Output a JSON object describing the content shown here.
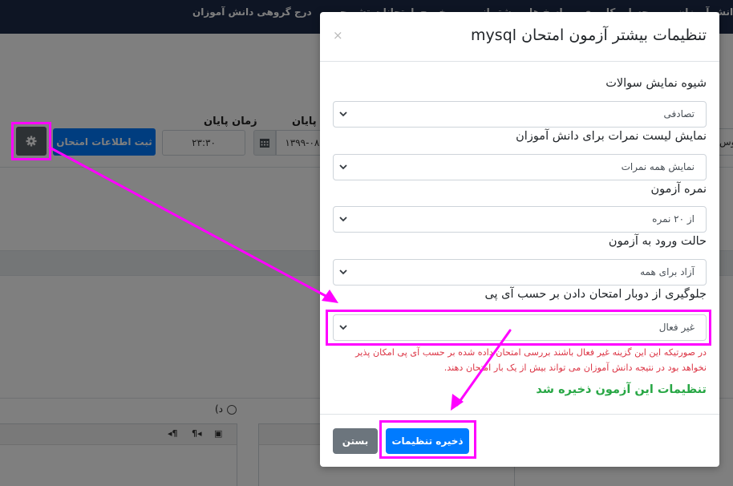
{
  "background": {
    "nav_items": [
      "دانش آموزان",
      "حساب کاربری",
      "پاسخ ها",
      "پشتیبانی",
      "خروج",
      "امتحانات تشریحی",
      "درج گروهی دانش آموزان"
    ],
    "end_date_label": "تاریخ پایان",
    "end_date_value": "۱۳۹۹-۰۸-",
    "end_time_label": "زمان پایان",
    "end_time_value": "۲۳:۳۰",
    "register_button": "ثبت اطلاعات امتحان",
    "right_cut_text": "توس",
    "option_d": "د)",
    "gear_icon": "gear-icon",
    "calendar_icon": "calendar-icon",
    "editor_icons": [
      "image-icon",
      "paragraph-rtl-icon",
      "paragraph-ltr-icon"
    ]
  },
  "modal": {
    "title": "تنظیمات بیشتر آزمون امتحان mysql",
    "close_glyph": "×",
    "fields": [
      {
        "label": "شیوه نمایش سوالات",
        "value": "تصادفی"
      },
      {
        "label": "نمایش لیست نمرات برای دانش آموزان",
        "value": "نمایش همه نمرات"
      },
      {
        "label": "نمره آزمون",
        "value": "از ۲۰ نمره"
      },
      {
        "label": "حالت ورود به آزمون",
        "value": "آزاد برای همه"
      },
      {
        "label": "جلوگیری از دوبار امتحان دادن بر حسب آی پی",
        "value": "غیر فعال"
      }
    ],
    "help_text": "در صورتیکه این این گزینه غیر فعال باشند بررسی امتحان داده شده بر حسب آی پی امکان پذیر نخواهد بود در نتیجه دانش آموزان می تواند بیش از یک بار امتحان دهند.",
    "success_text": "تنظیمات این آزمون ذخیره شد",
    "save_button": "ذخیره تنظیمات",
    "close_button": "بستن"
  },
  "colors": {
    "primary": "#007bff",
    "secondary": "#6c757d",
    "danger": "#dc3545",
    "success": "#28a745",
    "navbar": "#1c2a49",
    "annotation": "#ff00ff"
  }
}
